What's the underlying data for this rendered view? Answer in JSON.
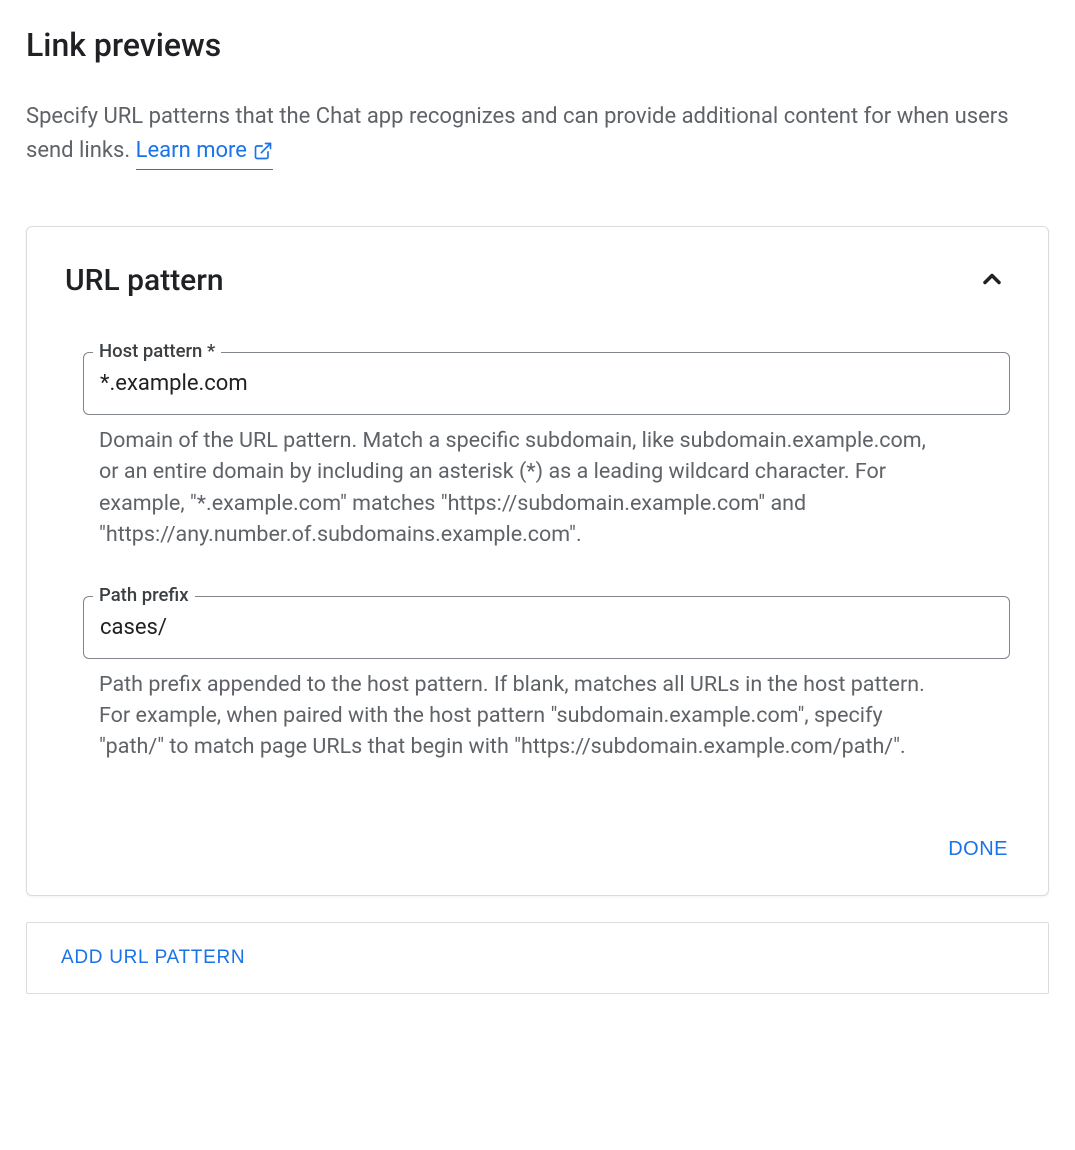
{
  "header": {
    "title": "Link previews",
    "description_prefix": "Specify URL patterns that the Chat app recognizes and can provide additional content for when users send links. ",
    "learn_more_label": "Learn more"
  },
  "card": {
    "title": "URL pattern",
    "fields": {
      "host_pattern": {
        "label": "Host pattern *",
        "value": "*.example.com",
        "help": "Domain of the URL pattern. Match a specific subdomain, like subdomain.example.com, or an entire domain by including an asterisk (*) as a leading wildcard character. For example, \"*.example.com\" matches \"https://subdomain.example.com\" and \"https://any.number.of.subdomains.example.com\"."
      },
      "path_prefix": {
        "label": "Path prefix",
        "value": "cases/",
        "help": "Path prefix appended to the host pattern. If blank, matches all URLs in the host pattern. For example, when paired with the host pattern \"subdomain.example.com\", specify \"path/\" to match page URLs that begin with \"https://subdomain.example.com/path/\"."
      }
    },
    "done_label": "DONE"
  },
  "add_button_label": "ADD URL PATTERN"
}
